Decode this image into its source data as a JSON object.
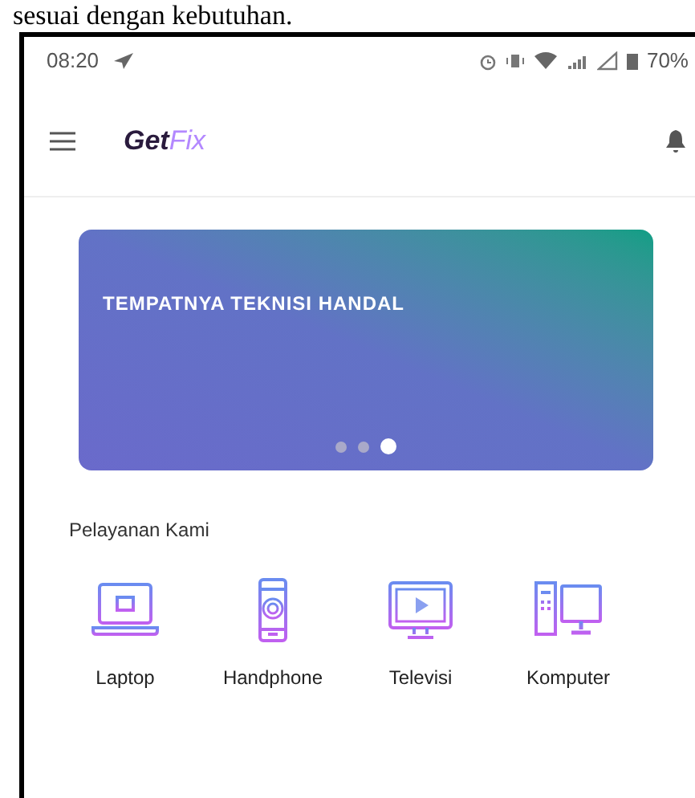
{
  "document_text": "sesuai dengan kebutuhan.",
  "status_bar": {
    "time": "08:20",
    "battery": "70%"
  },
  "app_bar": {
    "logo_part_1": "Get",
    "logo_part_2": "Fix"
  },
  "banner": {
    "title": "TEMPATNYA TEKNISI HANDAL",
    "dots": [
      {
        "selected": false
      },
      {
        "selected": false
      },
      {
        "selected": true
      }
    ]
  },
  "services": {
    "heading": "Pelayanan Kami",
    "items": [
      {
        "kind": "laptop",
        "label": "Laptop"
      },
      {
        "kind": "phone",
        "label": "Handphone"
      },
      {
        "kind": "tv",
        "label": "Televisi"
      },
      {
        "kind": "computer",
        "label": "Komputer"
      }
    ]
  }
}
